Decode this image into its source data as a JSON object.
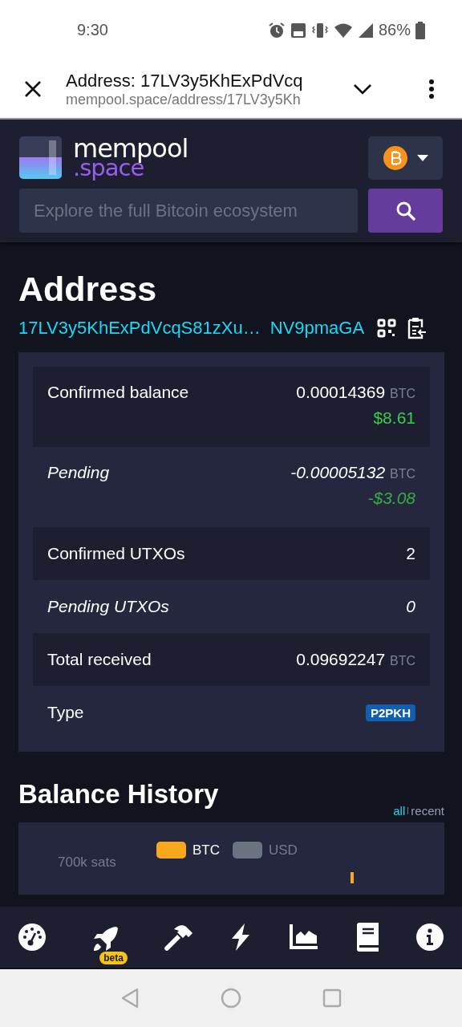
{
  "status_bar": {
    "time": "9:30",
    "battery": "86%"
  },
  "browser_bar": {
    "title": "Address: 17LV3y5KhExPdVcq",
    "url": "mempool.space/address/17LV3y5Kh"
  },
  "header": {
    "logo_top": "mempool",
    "logo_bottom": ".space",
    "search": {
      "placeholder": "Explore the full Bitcoin ecosystem"
    }
  },
  "address": {
    "title": "Address",
    "address_start": "17LV3y5KhExPdVcqS81zXu…",
    "address_end": "NV9pmaGA"
  },
  "summary_rows": [
    {
      "kind": "amount",
      "label": "Confirmed balance",
      "pending": false,
      "shaded": true,
      "amount": "0.00014369",
      "unit": "BTC",
      "fiat": "$8.61"
    },
    {
      "kind": "amount",
      "label": "Pending",
      "pending": true,
      "shaded": false,
      "amount": "-0.00005132",
      "unit": "BTC",
      "fiat": "-$3.08"
    },
    {
      "kind": "count",
      "label": "Confirmed UTXOs",
      "pending": false,
      "shaded": true,
      "amount": "2"
    },
    {
      "kind": "count",
      "label": "Pending UTXOs",
      "pending": true,
      "shaded": false,
      "amount": "0"
    },
    {
      "kind": "amount",
      "label": "Total received",
      "pending": false,
      "shaded": true,
      "amount": "0.09692247",
      "unit": "BTC"
    },
    {
      "kind": "badge",
      "label": "Type",
      "pending": false,
      "shaded": false,
      "badge": "P2PKH"
    }
  ],
  "balance_history": {
    "title": "Balance History",
    "ranges": [
      {
        "label": "all",
        "selected": true
      },
      {
        "label": "recent",
        "selected": false
      }
    ],
    "y_label": "700k sats",
    "legend": [
      {
        "label": "BTC",
        "selected": true,
        "color": "#f7a91b"
      },
      {
        "label": "USD",
        "selected": false,
        "color": "#6b7280"
      }
    ]
  },
  "bottom_nav": {
    "beta_badge": "beta"
  }
}
